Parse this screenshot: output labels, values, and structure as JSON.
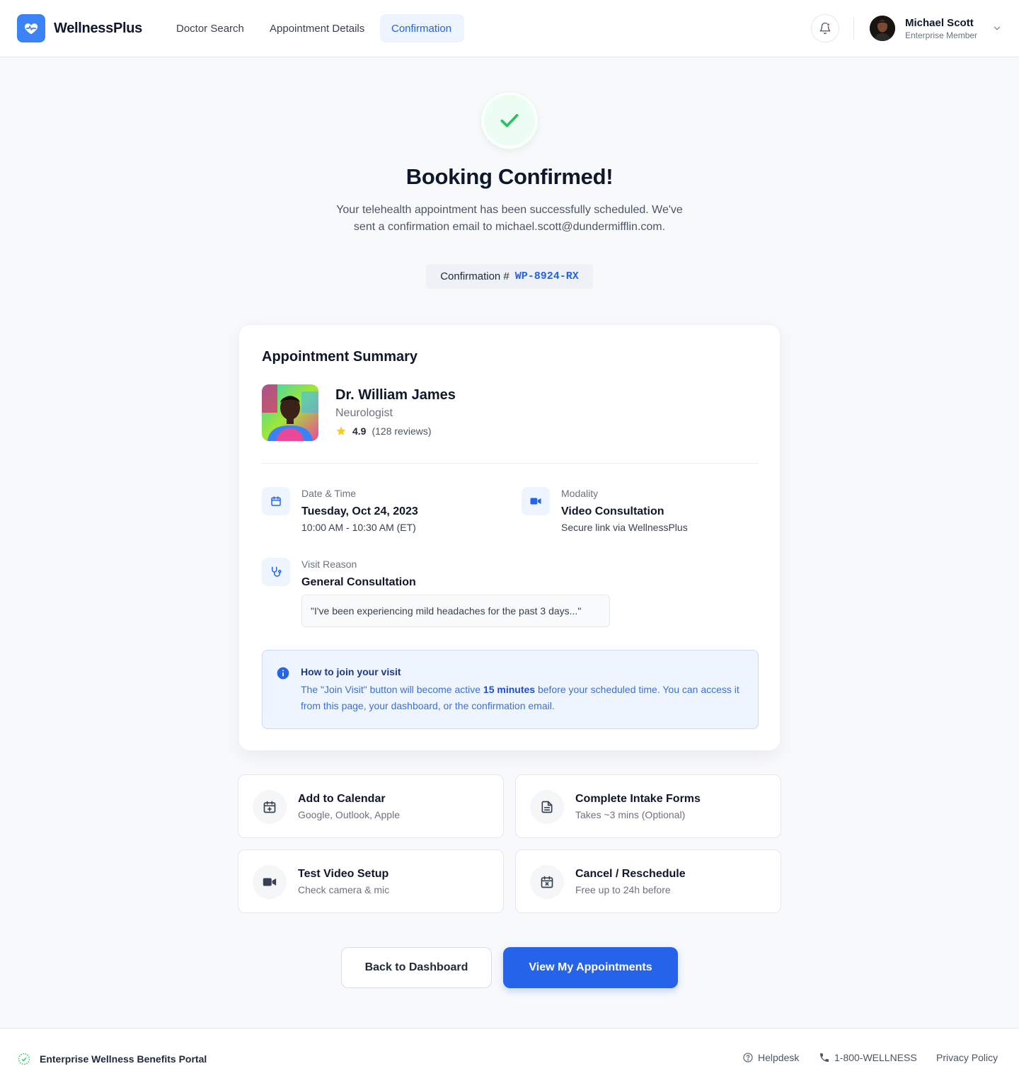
{
  "header": {
    "brand": "WellnessPlus",
    "nav": [
      {
        "label": "Doctor Search"
      },
      {
        "label": "Appointment Details"
      },
      {
        "label": "Confirmation"
      }
    ],
    "user": {
      "name": "Michael Scott",
      "role": "Enterprise Member"
    }
  },
  "hero": {
    "title": "Booking Confirmed!",
    "subtitle": "Your telehealth appointment has been successfully scheduled. We've sent a confirmation email to michael.scott@dundermifflin.com.",
    "confirmation_label": "Confirmation #",
    "confirmation_code": "WP-8924-RX"
  },
  "summary": {
    "title": "Appointment Summary",
    "doctor": {
      "name": "Dr. William James",
      "specialty": "Neurologist",
      "rating": "4.9",
      "reviews": "(128 reviews)"
    },
    "datetime": {
      "label": "Date & Time",
      "date": "Tuesday, Oct 24, 2023",
      "time": "10:00 AM - 10:30 AM (ET)"
    },
    "modality": {
      "label": "Modality",
      "value": "Video Consultation",
      "detail": "Secure link via WellnessPlus"
    },
    "reason": {
      "label": "Visit Reason",
      "value": "General Consultation",
      "quote": "\"I've been experiencing mild headaches for the past 3 days...\""
    },
    "info": {
      "title": "How to join your visit",
      "text_before": "The \"Join Visit\" button will become active ",
      "text_bold": "15 minutes",
      "text_after": " before your scheduled time. You can access it from this page, your dashboard, or the confirmation email."
    }
  },
  "actions": [
    {
      "title": "Add to Calendar",
      "subtitle": "Google, Outlook, Apple",
      "icon": "calendar-plus-icon"
    },
    {
      "title": "Complete Intake Forms",
      "subtitle": "Takes ~3 mins (Optional)",
      "icon": "file-text-icon"
    },
    {
      "title": "Test Video Setup",
      "subtitle": "Check camera & mic",
      "icon": "video-icon"
    },
    {
      "title": "Cancel / Reschedule",
      "subtitle": "Free up to 24h before",
      "icon": "calendar-x-icon"
    }
  ],
  "buttons": {
    "secondary": "Back to Dashboard",
    "primary": "View My Appointments"
  },
  "footer": {
    "portal": "Enterprise Wellness Benefits Portal",
    "helpdesk": "Helpdesk",
    "phone": "1-800-WELLNESS",
    "privacy": "Privacy Policy"
  },
  "colors": {
    "primary": "#2563eb",
    "success": "#22c55e",
    "star": "#facc15"
  }
}
